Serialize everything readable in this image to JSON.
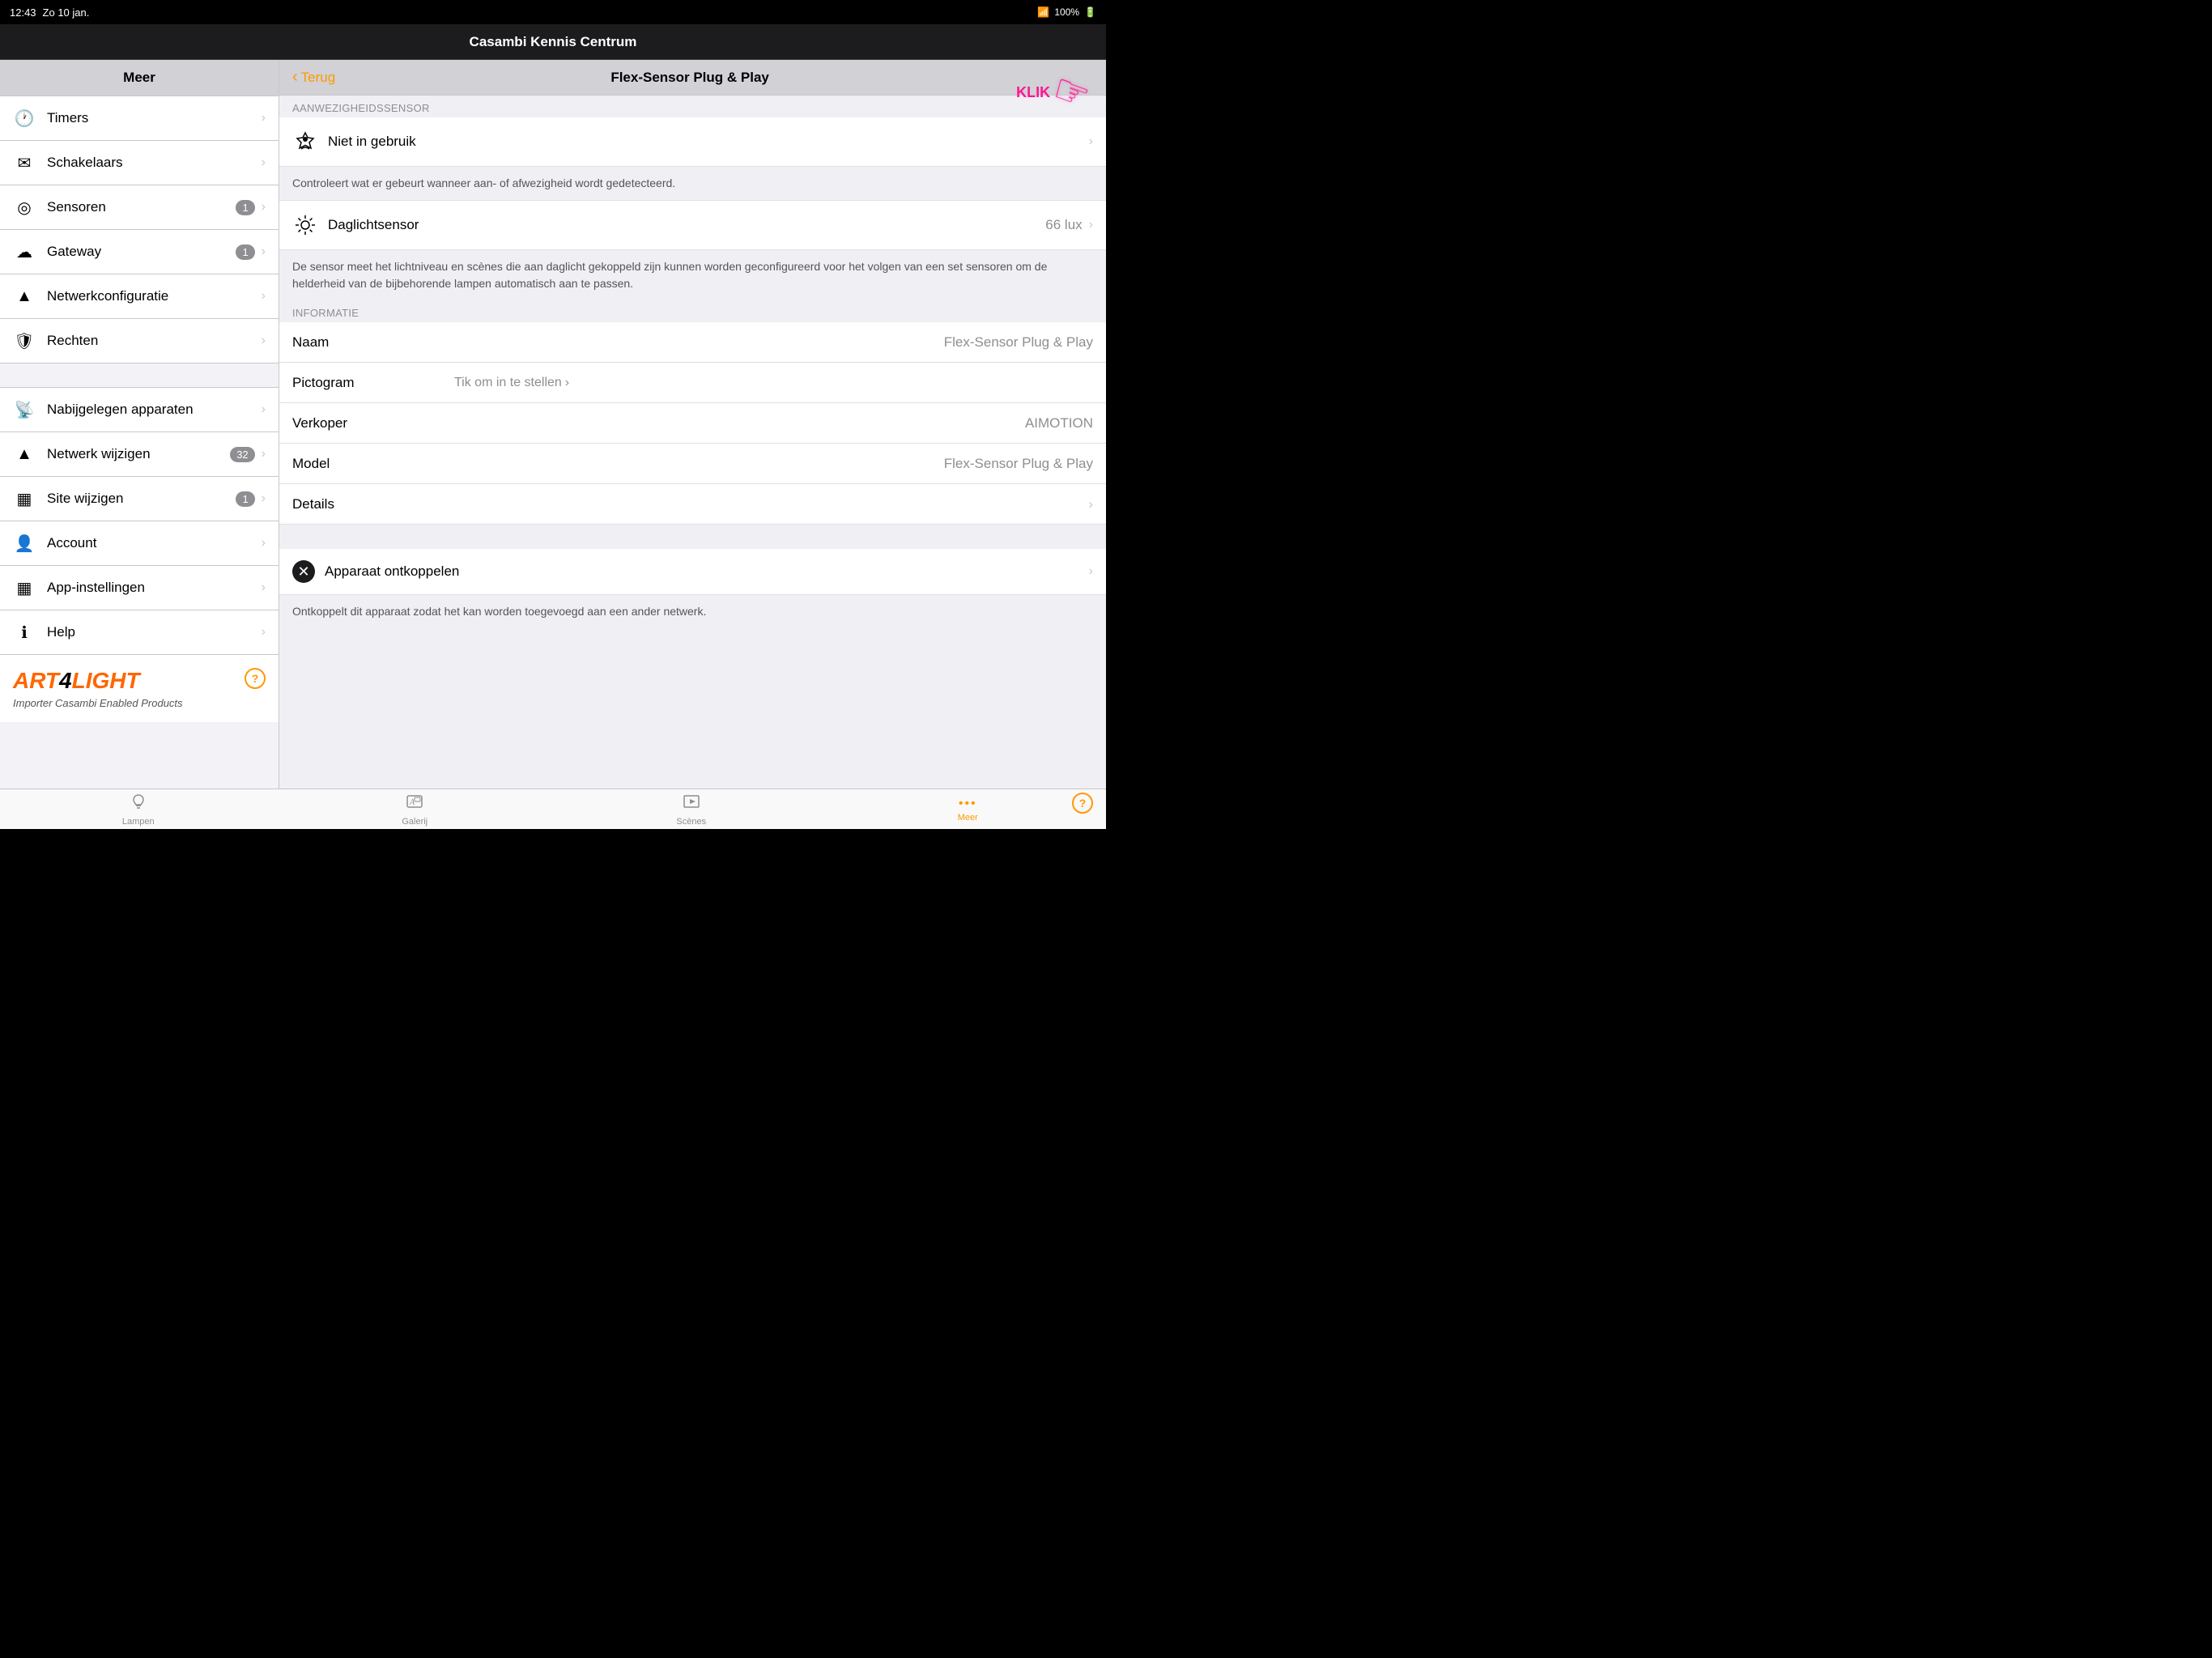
{
  "status_bar": {
    "time": "12:43",
    "day": "Zo 10 jan.",
    "wifi": "WiFi",
    "battery": "100%"
  },
  "title_bar": {
    "title": "Casambi Kennis Centrum"
  },
  "sidebar": {
    "header": "Meer",
    "items": [
      {
        "id": "timers",
        "icon": "🕐",
        "label": "Timers",
        "badge": "",
        "chevron": true
      },
      {
        "id": "schakelaars",
        "icon": "✉",
        "label": "Schakelaars",
        "badge": "",
        "chevron": true
      },
      {
        "id": "sensoren",
        "icon": "◎",
        "label": "Sensoren",
        "badge": "1",
        "chevron": true
      },
      {
        "id": "gateway",
        "icon": "☁",
        "label": "Gateway",
        "badge": "1",
        "chevron": true
      },
      {
        "id": "netwerkconfiguratie",
        "icon": "▲",
        "label": "Netwerkconfiguratie",
        "badge": "",
        "chevron": true
      },
      {
        "id": "rechten",
        "icon": "🛡",
        "label": "Rechten",
        "badge": "",
        "chevron": true
      }
    ],
    "items2": [
      {
        "id": "nabijgelegen",
        "icon": "📡",
        "label": "Nabijgelegen apparaten",
        "badge": "",
        "chevron": true
      },
      {
        "id": "netwerk-wijzigen",
        "icon": "▲",
        "label": "Netwerk wijzigen",
        "badge": "32",
        "chevron": true
      },
      {
        "id": "site-wijzigen",
        "icon": "▦",
        "label": "Site wijzigen",
        "badge": "1",
        "chevron": true
      },
      {
        "id": "account",
        "icon": "👤",
        "label": "Account",
        "badge": "",
        "chevron": true
      },
      {
        "id": "app-instellingen",
        "icon": "▦",
        "label": "App-instellingen",
        "badge": "",
        "chevron": true
      },
      {
        "id": "help",
        "icon": "ℹ",
        "label": "Help",
        "badge": "",
        "chevron": true
      }
    ],
    "logo_main": "ART",
    "logo_num": "4",
    "logo_light": "LIGHT",
    "tagline": "Importer Casambi Enabled Products",
    "help_icon": "?"
  },
  "detail": {
    "back_label": "Terug",
    "title": "Flex-Sensor Plug & Play",
    "sections": {
      "presence": {
        "header": "AANWEZIGHEIDSSENSOR",
        "label": "Niet in gebruik",
        "description": "Controleert wat er gebeurt wanneer aan- of afwezigheid wordt gedetecteerd.",
        "icon": "🔔"
      },
      "daylight": {
        "label": "Daglichtsensor",
        "value": "66 lux",
        "icon": "⚙",
        "description": "De sensor meet het lichtniveau en scènes die aan daglicht gekoppeld zijn kunnen worden geconfigureerd voor het volgen van een set sensoren om de helderheid van de bijbehorende lampen automatisch aan te passen."
      },
      "info_header": "INFORMATIE",
      "info_rows": [
        {
          "label": "Naam",
          "value": "Flex-Sensor Plug & Play",
          "link": false,
          "chevron": false
        },
        {
          "label": "Pictogram",
          "value": "Tik om in te stellen",
          "link": true,
          "chevron": true
        },
        {
          "label": "Verkoper",
          "value": "AIMOTION",
          "link": false,
          "chevron": false
        },
        {
          "label": "Model",
          "value": "Flex-Sensor Plug & Play",
          "link": false,
          "chevron": false
        },
        {
          "label": "Details",
          "value": "",
          "link": false,
          "chevron": true
        }
      ]
    },
    "disconnect": {
      "label": "Apparaat ontkoppelen",
      "description": "Ontkoppelt dit apparaat zodat het kan worden toegevoegd aan een ander netwerk."
    }
  },
  "tabs": [
    {
      "id": "lampen",
      "icon": "💡",
      "label": "Lampen",
      "active": false
    },
    {
      "id": "galerij",
      "icon": "🖼",
      "label": "Galerij",
      "active": false
    },
    {
      "id": "scenes",
      "icon": "🎬",
      "label": "Scènes",
      "active": false
    },
    {
      "id": "meer",
      "icon": "•••",
      "label": "Meer",
      "active": true
    }
  ],
  "overlay": {
    "klik_label": "KLIK",
    "finger": "👆"
  }
}
